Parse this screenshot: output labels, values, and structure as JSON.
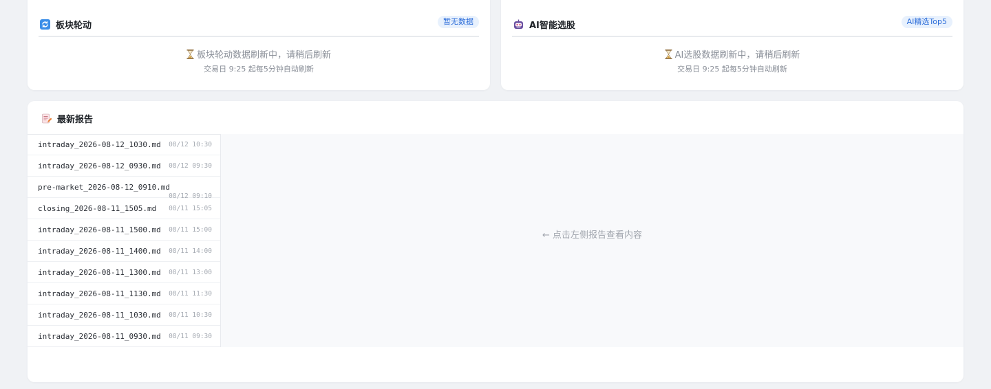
{
  "sector_card": {
    "title": "板块轮动",
    "icon": "refresh-icon",
    "badge": "暂无数据",
    "message": "板块轮动数据刷新中，请稍后刷新",
    "sub_message": "交易日 9:25 起每5分钟自动刷新"
  },
  "ai_card": {
    "title": "AI智能选股",
    "icon": "robot-icon",
    "badge": "AI精选Top5",
    "message": "AI选股数据刷新中，请稍后刷新",
    "sub_message": "交易日 9:25 起每5分钟自动刷新"
  },
  "reports_card": {
    "title": "最新报告",
    "icon": "memo-icon",
    "viewer_hint": "← 点击左侧报告查看内容",
    "items": [
      {
        "name": "intraday_2026-08-12_1030.md",
        "time": "08/12 10:30"
      },
      {
        "name": "intraday_2026-08-12_0930.md",
        "time": "08/12 09:30"
      },
      {
        "name": "pre-market_2026-08-12_0910.md",
        "time": "08/12 09:10"
      },
      {
        "name": "closing_2026-08-11_1505.md",
        "time": "08/11 15:05"
      },
      {
        "name": "intraday_2026-08-11_1500.md",
        "time": "08/11 15:00"
      },
      {
        "name": "intraday_2026-08-11_1400.md",
        "time": "08/11 14:00"
      },
      {
        "name": "intraday_2026-08-11_1300.md",
        "time": "08/11 13:00"
      },
      {
        "name": "intraday_2026-08-11_1130.md",
        "time": "08/11 11:30"
      },
      {
        "name": "intraday_2026-08-11_1030.md",
        "time": "08/11 10:30"
      },
      {
        "name": "intraday_2026-08-11_0930.md",
        "time": "08/11 09:30"
      }
    ]
  },
  "colors": {
    "badge_bg": "#e8f1fd",
    "badge_text": "#2b6cd9",
    "page_bg": "#f0f2f5"
  }
}
